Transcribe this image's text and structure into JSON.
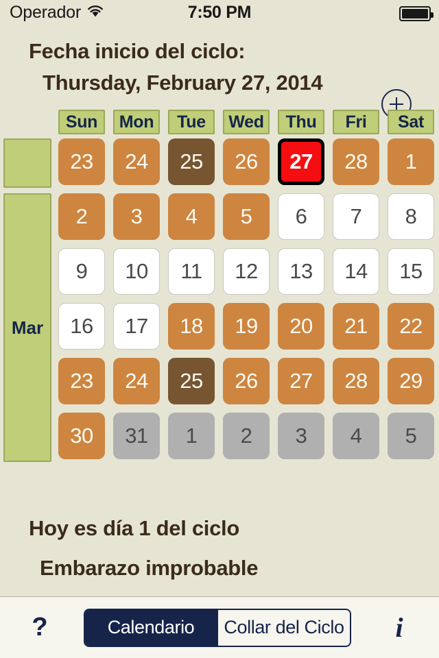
{
  "status_bar": {
    "carrier": "Operador",
    "wifi_icon": "wifi-icon",
    "time": "7:50 PM",
    "battery_icon": "battery-full-icon"
  },
  "header": {
    "label": "Fecha inicio del ciclo:",
    "date": "Thursday, February 27, 2014",
    "add_button_icon": "plus-circle-icon"
  },
  "calendar": {
    "day_headers": [
      "Sun",
      "Mon",
      "Tue",
      "Wed",
      "Thu",
      "Fri",
      "Sat"
    ],
    "month_labels": [
      "",
      "Mar"
    ],
    "weeks": [
      [
        {
          "n": "23",
          "state": "fertile"
        },
        {
          "n": "24",
          "state": "fertile"
        },
        {
          "n": "25",
          "state": "peak"
        },
        {
          "n": "26",
          "state": "fertile"
        },
        {
          "n": "27",
          "state": "today"
        },
        {
          "n": "28",
          "state": "fertile"
        },
        {
          "n": "1",
          "state": "fertile"
        }
      ],
      [
        {
          "n": "2",
          "state": "fertile"
        },
        {
          "n": "3",
          "state": "fertile"
        },
        {
          "n": "4",
          "state": "fertile"
        },
        {
          "n": "5",
          "state": "fertile"
        },
        {
          "n": "6",
          "state": "plain"
        },
        {
          "n": "7",
          "state": "plain"
        },
        {
          "n": "8",
          "state": "plain"
        }
      ],
      [
        {
          "n": "9",
          "state": "plain"
        },
        {
          "n": "10",
          "state": "plain"
        },
        {
          "n": "11",
          "state": "plain"
        },
        {
          "n": "12",
          "state": "plain"
        },
        {
          "n": "13",
          "state": "plain"
        },
        {
          "n": "14",
          "state": "plain"
        },
        {
          "n": "15",
          "state": "plain"
        }
      ],
      [
        {
          "n": "16",
          "state": "plain"
        },
        {
          "n": "17",
          "state": "plain"
        },
        {
          "n": "18",
          "state": "fertile"
        },
        {
          "n": "19",
          "state": "fertile"
        },
        {
          "n": "20",
          "state": "fertile"
        },
        {
          "n": "21",
          "state": "fertile"
        },
        {
          "n": "22",
          "state": "fertile"
        }
      ],
      [
        {
          "n": "23",
          "state": "fertile"
        },
        {
          "n": "24",
          "state": "fertile"
        },
        {
          "n": "25",
          "state": "peak"
        },
        {
          "n": "26",
          "state": "fertile"
        },
        {
          "n": "27",
          "state": "fertile"
        },
        {
          "n": "28",
          "state": "fertile"
        },
        {
          "n": "29",
          "state": "fertile"
        }
      ],
      [
        {
          "n": "30",
          "state": "fertile"
        },
        {
          "n": "31",
          "state": "disabled"
        },
        {
          "n": "1",
          "state": "disabled"
        },
        {
          "n": "2",
          "state": "disabled"
        },
        {
          "n": "3",
          "state": "disabled"
        },
        {
          "n": "4",
          "state": "disabled"
        },
        {
          "n": "5",
          "state": "disabled"
        }
      ]
    ]
  },
  "status_lines": {
    "line1": "Hoy es día 1 del ciclo",
    "line2": "Embarazo improbable"
  },
  "toolbar": {
    "help_label": "?",
    "info_label": "i",
    "segments": [
      {
        "label": "Calendario",
        "selected": true
      },
      {
        "label": "Collar del Ciclo",
        "selected": false
      }
    ]
  },
  "colors": {
    "background": "#e6e5d4",
    "fertile": "#cd8540",
    "peak": "#775531",
    "today": "#f40e12",
    "plain": "#ffffff",
    "disabled": "#b0b0b0",
    "header_green": "#c0ce79",
    "accent_navy": "#16244a",
    "text_brown": "#3b2b1d"
  }
}
